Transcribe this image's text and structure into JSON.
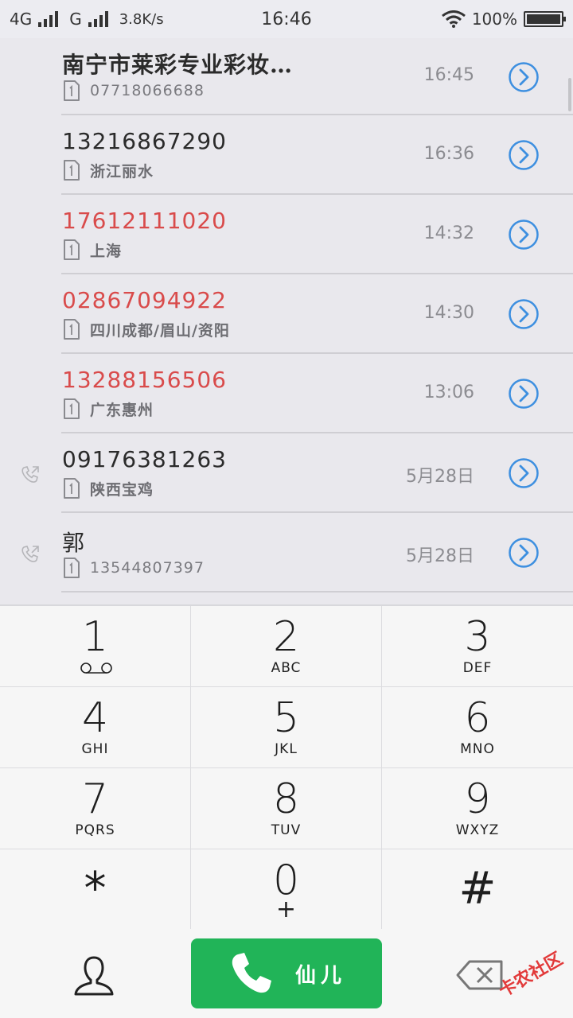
{
  "status_bar": {
    "network1": "4G",
    "network2": "G",
    "speed": "3.8K/s",
    "time": "16:46",
    "battery": "100%"
  },
  "colors": {
    "missed": "#d94b4b",
    "accent": "#3d8fe0",
    "call_button": "#21b458"
  },
  "calls": [
    {
      "name": "南宁市莱彩专业彩妆…",
      "sub": "07718066688",
      "sub_is_number": true,
      "time": "16:45",
      "missed": false,
      "icon": "none"
    },
    {
      "name": "13216867290",
      "sub": "浙江丽水",
      "sub_is_number": false,
      "time": "16:36",
      "missed": false,
      "icon": "none"
    },
    {
      "name": "17612111020",
      "sub": "上海",
      "sub_is_number": false,
      "time": "14:32",
      "missed": true,
      "icon": "none"
    },
    {
      "name": "02867094922",
      "sub": "四川成都/眉山/资阳",
      "sub_is_number": false,
      "time": "14:30",
      "missed": true,
      "icon": "none"
    },
    {
      "name": "13288156506",
      "sub": "广东惠州",
      "sub_is_number": false,
      "time": "13:06",
      "missed": true,
      "icon": "none"
    },
    {
      "name": "09176381263",
      "sub": "陕西宝鸡",
      "sub_is_number": false,
      "time": "5月28日",
      "missed": false,
      "icon": "outgoing-call-icon"
    },
    {
      "name": "郭",
      "sub": "13544807397",
      "sub_is_number": true,
      "time": "5月28日",
      "missed": false,
      "icon": "outgoing-call-icon"
    }
  ],
  "keypad": [
    {
      "digit": "1",
      "letters": "",
      "voicemail": true
    },
    {
      "digit": "2",
      "letters": "ABC"
    },
    {
      "digit": "3",
      "letters": "DEF"
    },
    {
      "digit": "4",
      "letters": "GHI"
    },
    {
      "digit": "5",
      "letters": "JKL"
    },
    {
      "digit": "6",
      "letters": "MNO"
    },
    {
      "digit": "7",
      "letters": "PQRS"
    },
    {
      "digit": "8",
      "letters": "TUV"
    },
    {
      "digit": "9",
      "letters": "WXYZ"
    },
    {
      "digit": "*",
      "letters": ""
    },
    {
      "digit": "0",
      "letters": "+"
    },
    {
      "digit": "#",
      "letters": ""
    }
  ],
  "bottom_bar": {
    "call_label": "仙儿",
    "watermark": "卡农社区"
  }
}
